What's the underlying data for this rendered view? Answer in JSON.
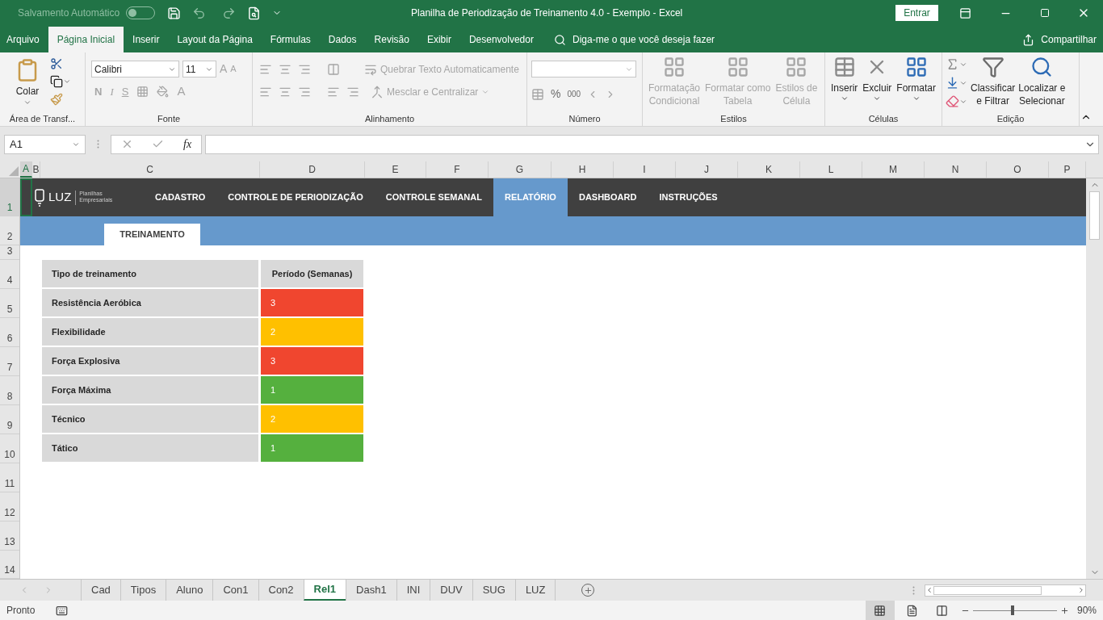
{
  "title_bar": {
    "autosave_label": "Salvamento Automático",
    "autosave_on": false,
    "title": "Planilha de Periodização de Treinamento 4.0 - Exemplo  -  Excel",
    "sign_in": "Entrar"
  },
  "ribbon_tabs": [
    {
      "label": "Arquivo",
      "selected": false
    },
    {
      "label": "Página Inicial",
      "selected": true
    },
    {
      "label": "Inserir",
      "selected": false
    },
    {
      "label": "Layout da Página",
      "selected": false
    },
    {
      "label": "Fórmulas",
      "selected": false
    },
    {
      "label": "Dados",
      "selected": false
    },
    {
      "label": "Revisão",
      "selected": false
    },
    {
      "label": "Exibir",
      "selected": false
    },
    {
      "label": "Desenvolvedor",
      "selected": false
    }
  ],
  "tell_me": "Diga-me o que você deseja fazer",
  "share": "Compartilhar",
  "ribbon": {
    "clipboard": {
      "paste": "Colar",
      "group": "Área de Transf..."
    },
    "font": {
      "font_name": "Calibri",
      "font_size": "11",
      "bold": "N",
      "italic": "I",
      "underline": "S",
      "font_color": "A",
      "grow": "A",
      "shrink": "A",
      "group": "Fonte"
    },
    "alignment": {
      "wrap": "Quebrar Texto Automaticamente",
      "merge": "Mesclar e Centralizar",
      "disabled": true,
      "group": "Alinhamento"
    },
    "number": {
      "percent": "%",
      "thousands": "000",
      "group": "Número"
    },
    "styles": {
      "buttons": [
        {
          "line1": "Formatação",
          "line2": "Condicional",
          "disabled": true
        },
        {
          "line1": "Formatar como",
          "line2": "Tabela",
          "disabled": true
        },
        {
          "line1": "Estilos de",
          "line2": "Célula",
          "disabled": true
        }
      ],
      "group": "Estilos"
    },
    "cells": {
      "buttons": [
        {
          "label": "Inserir",
          "kind": "insert"
        },
        {
          "label": "Excluir",
          "kind": "delete"
        },
        {
          "label": "Formatar",
          "kind": "format"
        }
      ],
      "group": "Células"
    },
    "editing": {
      "sort": [
        "Classificar",
        "e Filtrar"
      ],
      "find": [
        "Localizar e",
        "Selecionar"
      ],
      "group": "Edição"
    }
  },
  "formula_bar": {
    "name_box": "A1",
    "fx": "fx"
  },
  "columns": [
    {
      "label": "A",
      "selected": true
    },
    {
      "label": "B",
      "selected": false
    },
    {
      "label": "C",
      "selected": false
    },
    {
      "label": "D",
      "selected": false
    },
    {
      "label": "E",
      "selected": false
    },
    {
      "label": "F",
      "selected": false
    },
    {
      "label": "G",
      "selected": false
    },
    {
      "label": "H",
      "selected": false
    },
    {
      "label": "I",
      "selected": false
    },
    {
      "label": "J",
      "selected": false
    },
    {
      "label": "K",
      "selected": false
    },
    {
      "label": "L",
      "selected": false
    },
    {
      "label": "M",
      "selected": false
    },
    {
      "label": "N",
      "selected": false
    },
    {
      "label": "O",
      "selected": false
    },
    {
      "label": "P",
      "selected": false
    }
  ],
  "rows": [
    {
      "label": "1",
      "selected": true
    },
    {
      "label": "2",
      "selected": false
    },
    {
      "label": "3",
      "selected": false
    },
    {
      "label": "4",
      "selected": false
    },
    {
      "label": "5",
      "selected": false
    },
    {
      "label": "6",
      "selected": false
    },
    {
      "label": "7",
      "selected": false
    },
    {
      "label": "8",
      "selected": false
    },
    {
      "label": "9",
      "selected": false
    },
    {
      "label": "10",
      "selected": false
    },
    {
      "label": "11",
      "selected": false
    },
    {
      "label": "12",
      "selected": false
    },
    {
      "label": "13",
      "selected": false
    },
    {
      "label": "14",
      "selected": false
    }
  ],
  "logo": {
    "name": "LUZ",
    "tagline_1": "Planilhas",
    "tagline_2": "Empresariais"
  },
  "nav": [
    {
      "label": "CADASTRO",
      "selected": false
    },
    {
      "label": "CONTROLE DE PERIODIZAÇÃO",
      "selected": false
    },
    {
      "label": "CONTROLE SEMANAL",
      "selected": false
    },
    {
      "label": "RELATÓRIO",
      "selected": true
    },
    {
      "label": "DASHBOARD",
      "selected": false
    },
    {
      "label": "INSTRUÇÕES",
      "selected": false
    }
  ],
  "subtab": "TREINAMENTO",
  "table": {
    "headers": [
      "Tipo de treinamento",
      "Período (Semanas)"
    ],
    "rows": [
      {
        "type": "Resistência Aeróbica",
        "weeks": "3",
        "color": "#f0462f"
      },
      {
        "type": "Flexibilidade",
        "weeks": "2",
        "color": "#ffc000"
      },
      {
        "type": "Força Explosiva",
        "weeks": "3",
        "color": "#f0462f"
      },
      {
        "type": "Força Máxima",
        "weeks": "1",
        "color": "#55b03e"
      },
      {
        "type": "Técnico",
        "weeks": "2",
        "color": "#ffc000"
      },
      {
        "type": "Tático",
        "weeks": "1",
        "color": "#55b03e"
      }
    ]
  },
  "sheet_tabs": [
    {
      "label": "Cad",
      "selected": false
    },
    {
      "label": "Tipos",
      "selected": false
    },
    {
      "label": "Aluno",
      "selected": false
    },
    {
      "label": "Con1",
      "selected": false
    },
    {
      "label": "Con2",
      "selected": false
    },
    {
      "label": "Rel1",
      "selected": true
    },
    {
      "label": "Dash1",
      "selected": false
    },
    {
      "label": "INI",
      "selected": false
    },
    {
      "label": "DUV",
      "selected": false
    },
    {
      "label": "SUG",
      "selected": false
    },
    {
      "label": "LUZ",
      "selected": false
    }
  ],
  "status_bar": {
    "status": "Pronto",
    "zoom": "90%",
    "zoom_slider": {
      "level": 0.47
    }
  }
}
